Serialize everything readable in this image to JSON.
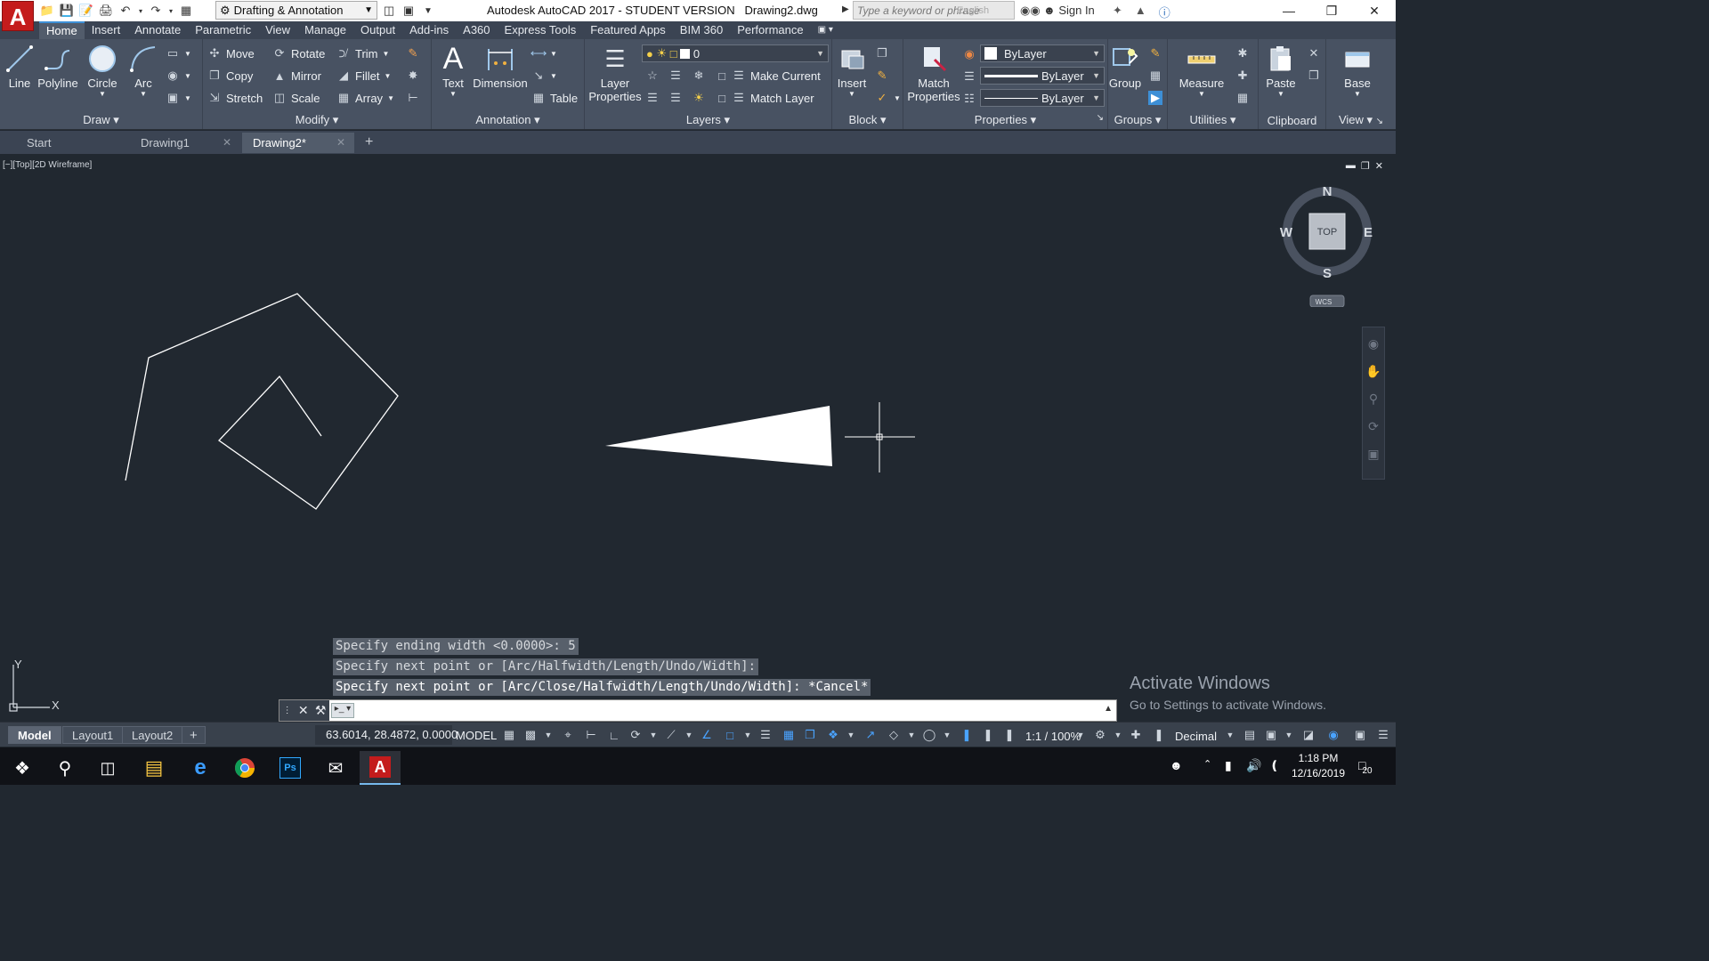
{
  "titlebar": {
    "workspace": "Drafting & Annotation",
    "title": "Autodesk AutoCAD 2017 - STUDENT VERSION",
    "filename": "Drawing2.dwg",
    "search_placeholder": "Type a keyword or phrase",
    "search_overlay": "English",
    "signin": "Sign In"
  },
  "ribbon_tabs": [
    "Home",
    "Insert",
    "Annotate",
    "Parametric",
    "View",
    "Manage",
    "Output",
    "Add-ins",
    "A360",
    "Express Tools",
    "Featured Apps",
    "BIM 360",
    "Performance"
  ],
  "draw": {
    "title": "Draw",
    "line": "Line",
    "polyline": "Polyline",
    "circle": "Circle",
    "arc": "Arc"
  },
  "modify": {
    "title": "Modify",
    "move": "Move",
    "rotate": "Rotate",
    "trim": "Trim",
    "copy": "Copy",
    "mirror": "Mirror",
    "fillet": "Fillet",
    "stretch": "Stretch",
    "scale": "Scale",
    "array": "Array"
  },
  "annotation": {
    "title": "Annotation",
    "text": "Text",
    "dimension": "Dimension",
    "table": "Table"
  },
  "layers": {
    "title": "Layers",
    "layer_properties_1": "Layer",
    "layer_properties_2": "Properties",
    "current_layer": "0",
    "make_current": "Make Current",
    "match_layer": "Match Layer"
  },
  "block": {
    "title": "Block",
    "insert": "Insert"
  },
  "properties": {
    "title": "Properties",
    "match_1": "Match",
    "match_2": "Properties",
    "color": "ByLayer",
    "lineweight": "ByLayer",
    "linetype": "ByLayer"
  },
  "groups": {
    "title": "Groups",
    "group": "Group"
  },
  "utilities": {
    "title": "Utilities",
    "measure": "Measure"
  },
  "clipboard": {
    "title": "Clipboard",
    "paste": "Paste"
  },
  "view_panel": {
    "title": "View",
    "base": "Base"
  },
  "doc_tabs": [
    "Start",
    "Drawing1",
    "Drawing2*"
  ],
  "viewport": {
    "label": "[−][Top][2D Wireframe]"
  },
  "viewcube": {
    "north": "N",
    "south": "S",
    "east": "E",
    "west": "W",
    "face": "TOP",
    "wcs": "WCS"
  },
  "ucs": {
    "x": "X",
    "y": "Y"
  },
  "command": {
    "history": [
      "Specify ending width <0.0000>: 5",
      "Specify next point or [Arc/Halfwidth/Length/Undo/Width]:",
      "Specify next point or [Arc/Close/Halfwidth/Length/Undo/Width]: *Cancel*"
    ],
    "value": ""
  },
  "activate": {
    "line1": "Activate Windows",
    "line2": "Go to Settings to activate Windows."
  },
  "status": {
    "layouts": [
      "Model",
      "Layout1",
      "Layout2"
    ],
    "coords": "63.6014, 28.4872, 0.0000",
    "model": "MODEL",
    "scale": "1:1 / 100%",
    "units": "Decimal"
  },
  "taskbar": {
    "time": "1:18 PM",
    "date": "12/16/2019",
    "notifications": "20"
  },
  "colors": {
    "canvas": "#212830",
    "ribbon": "#485262",
    "accent": "#3d8fd6",
    "logo": "#c41c1c"
  }
}
